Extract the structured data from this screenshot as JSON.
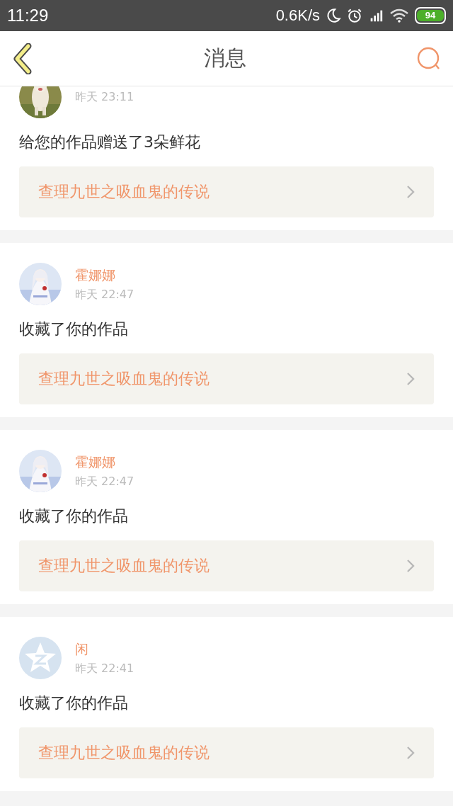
{
  "status_bar": {
    "time": "11:29",
    "speed": "0.6K/s",
    "battery": "94"
  },
  "header": {
    "title": "消息"
  },
  "messages": [
    {
      "time": "昨天 23:11",
      "text": "给您的作品赠送了3朵鲜花",
      "work": "查理九世之吸血鬼的传说"
    },
    {
      "name": "霍娜娜",
      "time": "昨天 22:47",
      "text": "收藏了你的作品",
      "work": "查理九世之吸血鬼的传说"
    },
    {
      "name": "霍娜娜",
      "time": "昨天 22:47",
      "text": "收藏了你的作品",
      "work": "查理九世之吸血鬼的传说"
    },
    {
      "avatar": {
        "kind": "default"
      },
      "name": "闲",
      "time": "昨天 22:41",
      "text": "收藏了你的作品",
      "work": "查理九世之吸血鬼的传说"
    }
  ]
}
